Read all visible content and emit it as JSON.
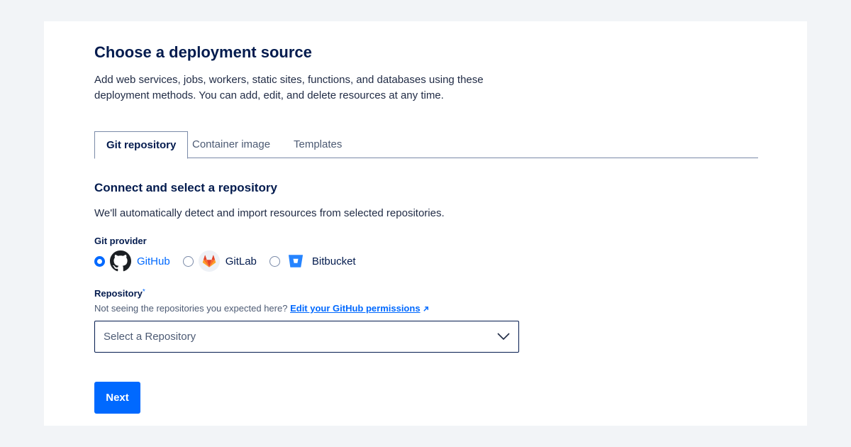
{
  "header": {
    "title": "Choose a deployment source",
    "description": "Add web services, jobs, workers, static sites, functions, and databases using these deployment methods. You can add, edit, and delete resources at any time."
  },
  "tabs": [
    {
      "label": "Git repository",
      "active": true
    },
    {
      "label": "Container image",
      "active": false
    },
    {
      "label": "Templates",
      "active": false
    }
  ],
  "section": {
    "title": "Connect and select a repository",
    "description": "We'll automatically detect and import resources from selected repositories."
  },
  "provider_field": {
    "label": "Git provider",
    "options": [
      {
        "label": "GitHub",
        "icon": "github-icon",
        "selected": true
      },
      {
        "label": "GitLab",
        "icon": "gitlab-icon",
        "selected": false
      },
      {
        "label": "Bitbucket",
        "icon": "bitbucket-icon",
        "selected": false
      }
    ]
  },
  "repository_field": {
    "label": "Repository",
    "required_mark": "*",
    "hint": "Not seeing the repositories you expected here?",
    "hint_link": "Edit your GitHub permissions",
    "placeholder": "Select a Repository"
  },
  "actions": {
    "next_label": "Next"
  },
  "colors": {
    "accent": "#0069ff",
    "text": "#031b4e",
    "background": "#f2f4f7",
    "gitlab": "#e24329",
    "bitbucket": "#2684ff"
  }
}
